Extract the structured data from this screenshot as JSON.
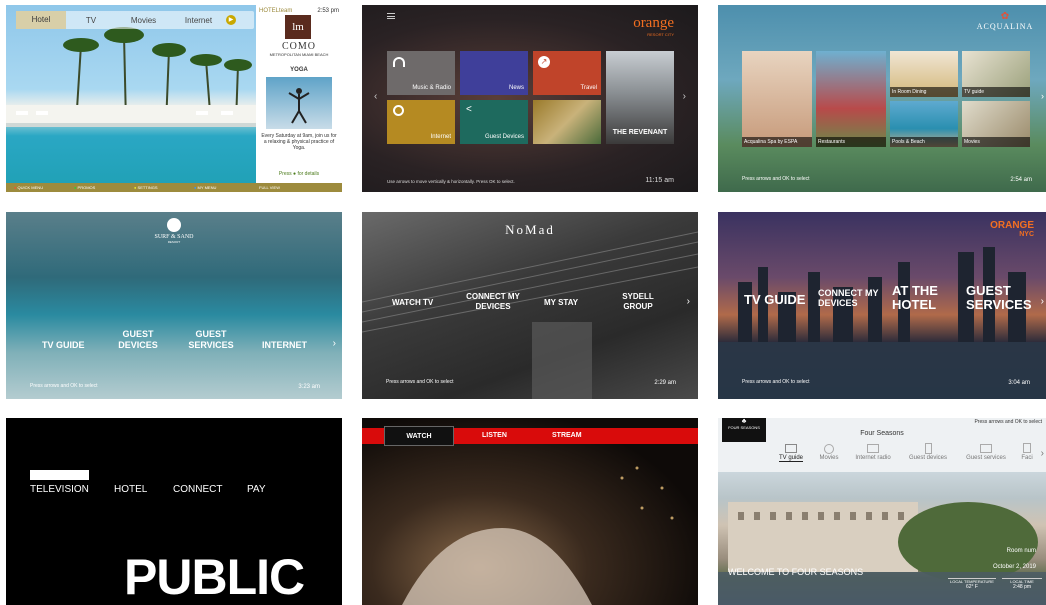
{
  "p1": {
    "tabs": [
      "Hotel",
      "TV",
      "Movies",
      "Internet"
    ],
    "brand_header": "HOTELteam",
    "time": "2:53 pm",
    "logo_letter": "lm",
    "brand_name": "COMO",
    "brand_sub": "METROPOLITAN MIAMI BEACH",
    "card_title": "YOGA",
    "card_text": "Every Saturday at 9am, join us for a relaxing & physical practice of Yoga.",
    "cta": "Press ● for details",
    "bottom_right": "FULL VIEW",
    "footer": [
      "QUICK MENU",
      "PROMOS",
      "SETTINGS",
      "MY MENU"
    ]
  },
  "p2": {
    "logo": "orange",
    "logo_sub": "RESORT CITY",
    "tiles": [
      "Music & Radio",
      "News",
      "Travel",
      "Internet",
      "Guest Devices"
    ],
    "poster_title": "THE REVENANT",
    "hint": "Use arrows to move vertically & horizontally. Press OK to select.",
    "time": "11:15 am"
  },
  "p3": {
    "logo": "ACQUALINA",
    "tiles": [
      "Acqualina Spa by ESPA",
      "Restaurants",
      "In Room Dining",
      "TV guide",
      "Pools & Beach",
      "Movies"
    ],
    "hint": "Press arrows and OK to select",
    "time": "2:54 am"
  },
  "p4": {
    "logo": "SURF & SAND",
    "logo_sub": "RESORT",
    "menu": [
      "TV GUIDE",
      "GUEST DEVICES",
      "GUEST SERVICES",
      "INTERNET"
    ],
    "hint": "Press arrows and OK to select",
    "time": "3:23 am"
  },
  "p5": {
    "logo": "NoMad",
    "menu": [
      "WATCH TV",
      "CONNECT MY DEVICES",
      "MY STAY",
      "SYDELL GROUP"
    ],
    "hint": "Press arrows and OK to select",
    "time": "2:29 am"
  },
  "p6": {
    "logo": "ORANGE",
    "logo_sub": "NYC",
    "menu": [
      "TV GUIDE",
      "CONNECT MY DEVICES",
      "AT THE HOTEL",
      "GUEST SERVICES"
    ],
    "hint": "Press arrows and OK to select",
    "time": "3:04 am"
  },
  "p7": {
    "menu": [
      "TELEVISION",
      "HOTEL",
      "CONNECT",
      "PAY"
    ],
    "brand": "PUBLIC"
  },
  "p8": {
    "menu": [
      "WATCH",
      "LISTEN",
      "STREAM"
    ]
  },
  "p9": {
    "top_hint": "Press arrows and OK to select",
    "logo": "FOUR SEASONS",
    "title": "Four Seasons",
    "nav": [
      "TV guide",
      "Movies",
      "Internet radio",
      "Guest devices",
      "Guest services",
      "Faci"
    ],
    "welcome": "WELCOME TO FOUR SEASONS",
    "room": "Room num",
    "date": "October 2, 2019",
    "temp_label": "LOCAL TEMPERATURE",
    "temp": "62° F",
    "localtime_label": "LOCAL TIME",
    "localtime": "2:48 pm"
  }
}
